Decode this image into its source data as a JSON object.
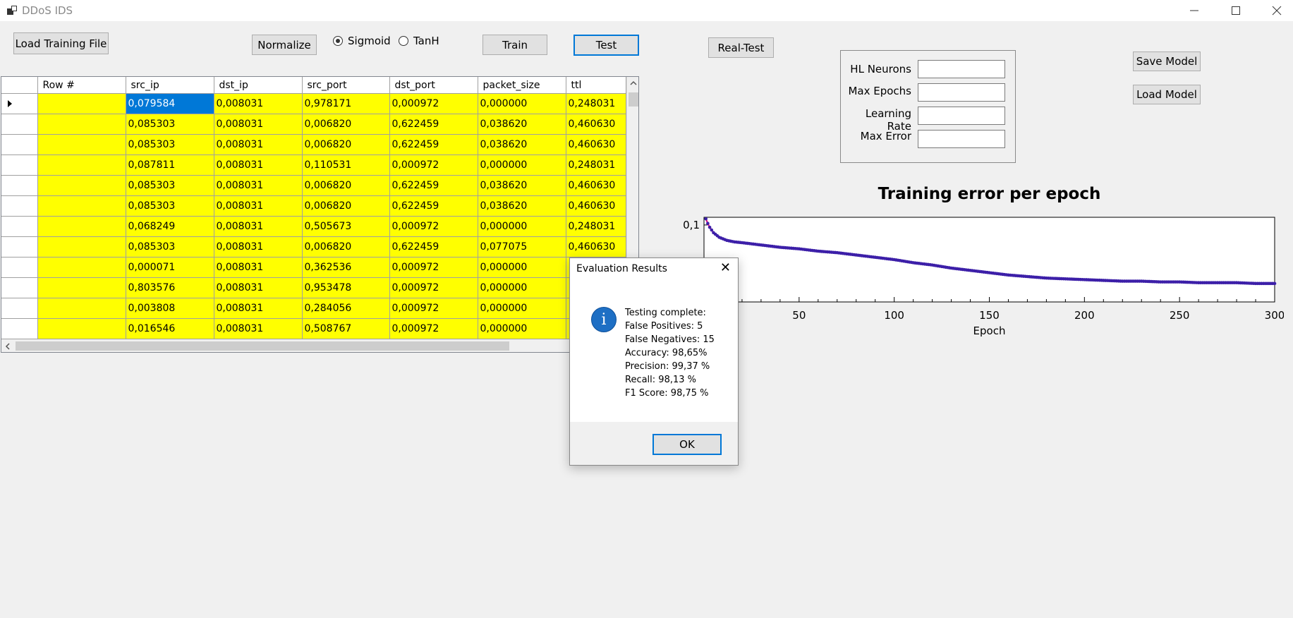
{
  "window": {
    "title": "DDoS IDS"
  },
  "toolbar": {
    "load_training_file": "Load Training File",
    "normalize": "Normalize",
    "sigmoid": "Sigmoid",
    "tanh": "TanH",
    "train": "Train",
    "test": "Test",
    "real_test": "Real-Test",
    "save_model": "Save Model",
    "load_model": "Load Model"
  },
  "params": {
    "hl_neurons_label": "HL Neurons",
    "max_epochs_label": "Max Epochs",
    "learning_rate_label": "Learning Rate",
    "max_error_label": "Max Error",
    "hl_neurons_value": "",
    "max_epochs_value": "",
    "learning_rate_value": "",
    "max_error_value": ""
  },
  "grid": {
    "columns": [
      "Row #",
      "src_ip",
      "dst_ip",
      "src_port",
      "dst_port",
      "packet_size",
      "ttl"
    ],
    "rows": [
      [
        "",
        "0,079584",
        "0,008031",
        "0,978171",
        "0,000972",
        "0,000000",
        "0,248031"
      ],
      [
        "",
        "0,085303",
        "0,008031",
        "0,006820",
        "0,622459",
        "0,038620",
        "0,460630"
      ],
      [
        "",
        "0,085303",
        "0,008031",
        "0,006820",
        "0,622459",
        "0,038620",
        "0,460630"
      ],
      [
        "",
        "0,087811",
        "0,008031",
        "0,110531",
        "0,000972",
        "0,000000",
        "0,248031"
      ],
      [
        "",
        "0,085303",
        "0,008031",
        "0,006820",
        "0,622459",
        "0,038620",
        "0,460630"
      ],
      [
        "",
        "0,085303",
        "0,008031",
        "0,006820",
        "0,622459",
        "0,038620",
        "0,460630"
      ],
      [
        "",
        "0,068249",
        "0,008031",
        "0,505673",
        "0,000972",
        "0,000000",
        "0,248031"
      ],
      [
        "",
        "0,085303",
        "0,008031",
        "0,006820",
        "0,622459",
        "0,077075",
        "0,460630"
      ],
      [
        "",
        "0,000071",
        "0,008031",
        "0,362536",
        "0,000972",
        "0,000000",
        ""
      ],
      [
        "",
        "0,803576",
        "0,008031",
        "0,953478",
        "0,000972",
        "0,000000",
        ""
      ],
      [
        "",
        "0,003808",
        "0,008031",
        "0,284056",
        "0,000972",
        "0,000000",
        ""
      ],
      [
        "",
        "0,016546",
        "0,008031",
        "0,508767",
        "0,000972",
        "0,000000",
        ""
      ]
    ]
  },
  "chart_data": {
    "type": "line",
    "title": "Training error per epoch",
    "xlabel": "Epoch",
    "ylabel": "",
    "x_ticks": [
      "50",
      "100",
      "150",
      "200",
      "250",
      "300"
    ],
    "y_ticks": [
      "0,1"
    ],
    "xlim": [
      0,
      300
    ],
    "ylim": [
      0,
      0.11
    ],
    "grid": false,
    "series": [
      {
        "color": "#e0007f",
        "marker_color": "#3c1fa8",
        "x": [
          1,
          2,
          3,
          5,
          8,
          12,
          16,
          20,
          30,
          40,
          50,
          60,
          70,
          80,
          90,
          100,
          110,
          120,
          130,
          140,
          150,
          160,
          170,
          180,
          190,
          200,
          210,
          220,
          230,
          240,
          250,
          260,
          270,
          280,
          290,
          300
        ],
        "y": [
          0.108,
          0.102,
          0.097,
          0.09,
          0.084,
          0.08,
          0.078,
          0.077,
          0.074,
          0.071,
          0.069,
          0.066,
          0.064,
          0.061,
          0.058,
          0.055,
          0.051,
          0.048,
          0.044,
          0.041,
          0.038,
          0.035,
          0.033,
          0.031,
          0.03,
          0.029,
          0.028,
          0.027,
          0.027,
          0.026,
          0.026,
          0.025,
          0.025,
          0.025,
          0.024,
          0.024
        ]
      }
    ]
  },
  "dialog": {
    "title": "Evaluation Results",
    "close": "✕",
    "lines": [
      "Testing complete:",
      "False Positives: 5",
      "False Negatives: 15",
      "Accuracy: 98,65%",
      "Precision: 99,37 %",
      "Recall: 98,13 %",
      "F1 Score: 98,75 %"
    ],
    "ok": "OK"
  }
}
